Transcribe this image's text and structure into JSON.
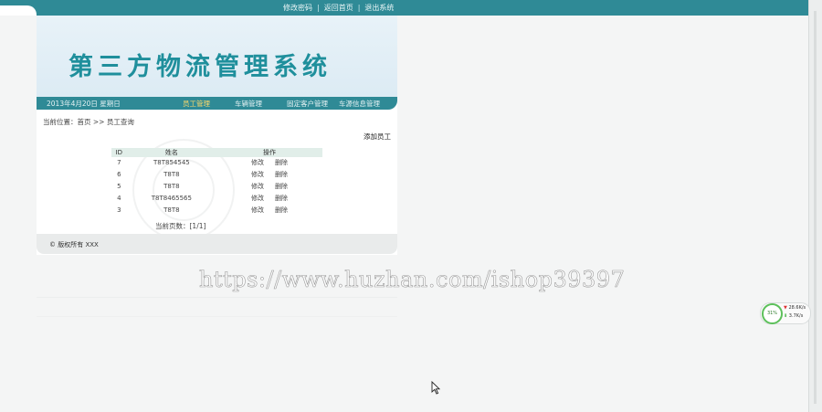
{
  "top_links": [
    "修改密码",
    "返回首页",
    "退出系统"
  ],
  "top_separator": "|",
  "banner": {
    "title": "第三方物流管理系统"
  },
  "nav": {
    "date": "2013年4月20日 星期日",
    "items": [
      "员工管理",
      "车辆管理",
      "固定客户管理",
      "车源信息管理"
    ],
    "active_index": 0
  },
  "breadcrumb": "当前位置：首页 >> 员工查询",
  "add_link": "添加员工",
  "table": {
    "headers": [
      "ID",
      "姓名",
      "操作"
    ],
    "rows": [
      {
        "id": "7",
        "name": "T8T854545",
        "edit": "修改",
        "delete": "删除"
      },
      {
        "id": "6",
        "name": "T8T8",
        "edit": "修改",
        "delete": "删除"
      },
      {
        "id": "5",
        "name": "T8T8",
        "edit": "修改",
        "delete": "删除"
      },
      {
        "id": "4",
        "name": "T8T8465565",
        "edit": "修改",
        "delete": "删除"
      },
      {
        "id": "3",
        "name": "T8T8",
        "edit": "修改",
        "delete": "删除"
      }
    ]
  },
  "pager": "当前页数：[1/1]",
  "footer": "© 版权所有 XXX",
  "watermark": "https://www.huzhan.com/ishop39397",
  "net_widget": {
    "percent": "31%",
    "upload": "28.6K/s",
    "download": "3.7K/s",
    "ring_color": "#5cc05a"
  },
  "colors": {
    "teal_bar": "#2f8a96",
    "title_teal": "#1f8f9c",
    "nav_active": "#ffd96a",
    "header_row": "#e1eee9"
  }
}
